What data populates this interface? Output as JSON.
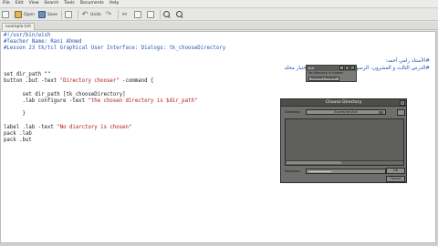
{
  "menu": {
    "items": [
      "File",
      "Edit",
      "View",
      "Search",
      "Tools",
      "Documents",
      "Help"
    ]
  },
  "toolbar": {
    "open_label": "Open",
    "save_label": "Save",
    "undo_label": "Undo"
  },
  "tabs": [
    {
      "label": "example.tcl"
    }
  ],
  "code_lines": [
    {
      "text": "#!/usr/bin/wish",
      "kind": "comment"
    },
    {
      "text": "#Teacher Name: Rani Ahmed",
      "kind": "comment"
    },
    {
      "text": "#Lesson 23 tk/tcl Graphical User Interface: Dialogs: tk_chooseDirectory",
      "kind": "comment"
    },
    {
      "text": "",
      "kind": "plain"
    },
    {
      "text": "",
      "kind": "plain"
    },
    {
      "text": "",
      "kind": "plain"
    },
    {
      "text": "set dir_path \"\"",
      "kind": "plain"
    },
    {
      "text": "button .but -text \"Directory chooser\" -command {",
      "kind": "mixed",
      "pre": "button .but -text ",
      "str": "\"Directory chooser\"",
      "post": " -command {"
    },
    {
      "text": "",
      "kind": "plain"
    },
    {
      "text": "      set dir_path [tk_chooseDirectory]",
      "kind": "plain"
    },
    {
      "text": "      .lab configure -text \"the chosen directory is $dir_path\"",
      "kind": "mixed",
      "pre": "      .lab configure -text ",
      "str": "\"the chosen directory is $dir_path\"",
      "post": ""
    },
    {
      "text": "",
      "kind": "plain"
    },
    {
      "text": "      }",
      "kind": "plain"
    },
    {
      "text": "",
      "kind": "plain"
    },
    {
      "text": "label .lab -text \"No diarctory is chosen\"",
      "kind": "mixed",
      "pre": "label .lab -text ",
      "str": "\"No diarctory is chosen\"",
      "post": ""
    },
    {
      "text": "pack .lab",
      "kind": "plain"
    },
    {
      "text": "pack .but",
      "kind": "plain"
    }
  ],
  "arabic_comments": {
    "line1": "#الأستاذ رامي أحمد:",
    "line2": "#الدرس الثالث و العشرون: الرسومية: إطارات المحادثة: اختيار محلد"
  },
  "tk_window": {
    "title": "but",
    "label": "No diarctory is chosen",
    "button": "Directory chooser",
    "close_glyph": "x",
    "min_glyph": "-",
    "max_glyph": "□"
  },
  "dialog": {
    "title": "Choose Directory",
    "directory_label": "Directory:",
    "directory_value": "/home/rani/bin",
    "name_label": "Selection:",
    "ok_label": "OK",
    "cancel_label": "Cancel",
    "close_glyph": "x"
  },
  "colors": {
    "comment": "#2a55b0",
    "string": "#b01818",
    "dialog_bg": "#6e6e6c"
  }
}
